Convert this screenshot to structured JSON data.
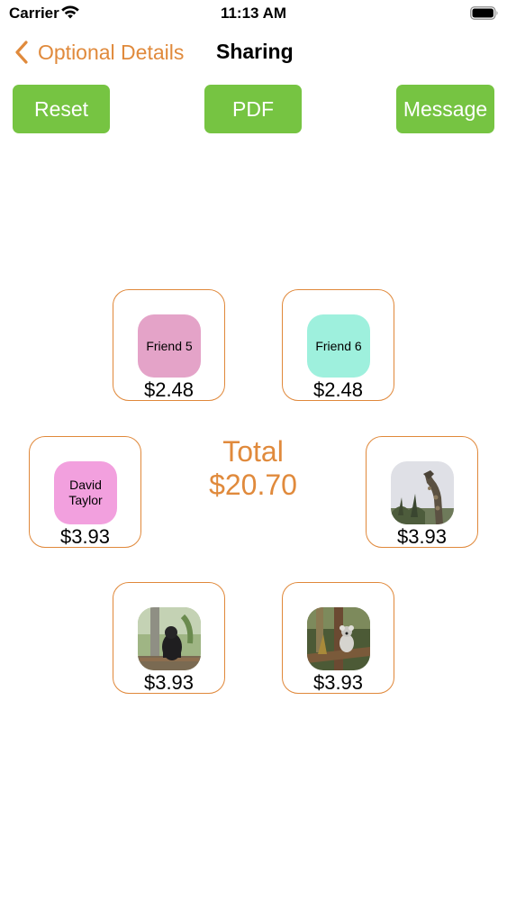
{
  "status_bar": {
    "carrier": "Carrier",
    "time": "11:13 AM"
  },
  "nav": {
    "back_label": "Optional Details",
    "title": "Sharing"
  },
  "actions": {
    "reset": "Reset",
    "pdf": "PDF",
    "message": "Message"
  },
  "colors": {
    "accent": "#e08a3c",
    "button_green": "#76c442",
    "friend5": "#e4a3c8",
    "friend6": "#9ef0dd",
    "david": "#f2a0de"
  },
  "participants": [
    {
      "label": "Friend 5",
      "amount": "$2.48"
    },
    {
      "label": "Friend 6",
      "amount": "$2.48"
    },
    {
      "label": "David Taylor",
      "amount": "$3.93"
    },
    {
      "label": "",
      "amount": "$3.93"
    },
    {
      "label": "",
      "amount": "$3.93"
    },
    {
      "label": "",
      "amount": "$3.93"
    }
  ],
  "total": {
    "label": "Total",
    "amount": "$20.70"
  }
}
